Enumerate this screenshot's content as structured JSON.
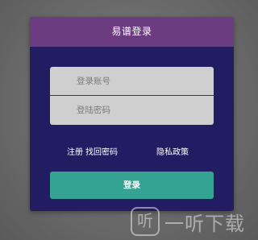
{
  "dialog": {
    "title": "易谱登录",
    "account_placeholder": "登录账号",
    "password_placeholder": "登陆密码",
    "register_link": "注册",
    "forgot_link": "找回密码",
    "privacy_link": "隐私政策",
    "login_button": "登录"
  },
  "watermark": {
    "icon_glyph": "听",
    "text": "一听下载"
  },
  "colors": {
    "header": "#6c3c80",
    "dialog_bg": "#221d62",
    "field_bg": "#cfcfcf",
    "login_button": "#35a392"
  }
}
